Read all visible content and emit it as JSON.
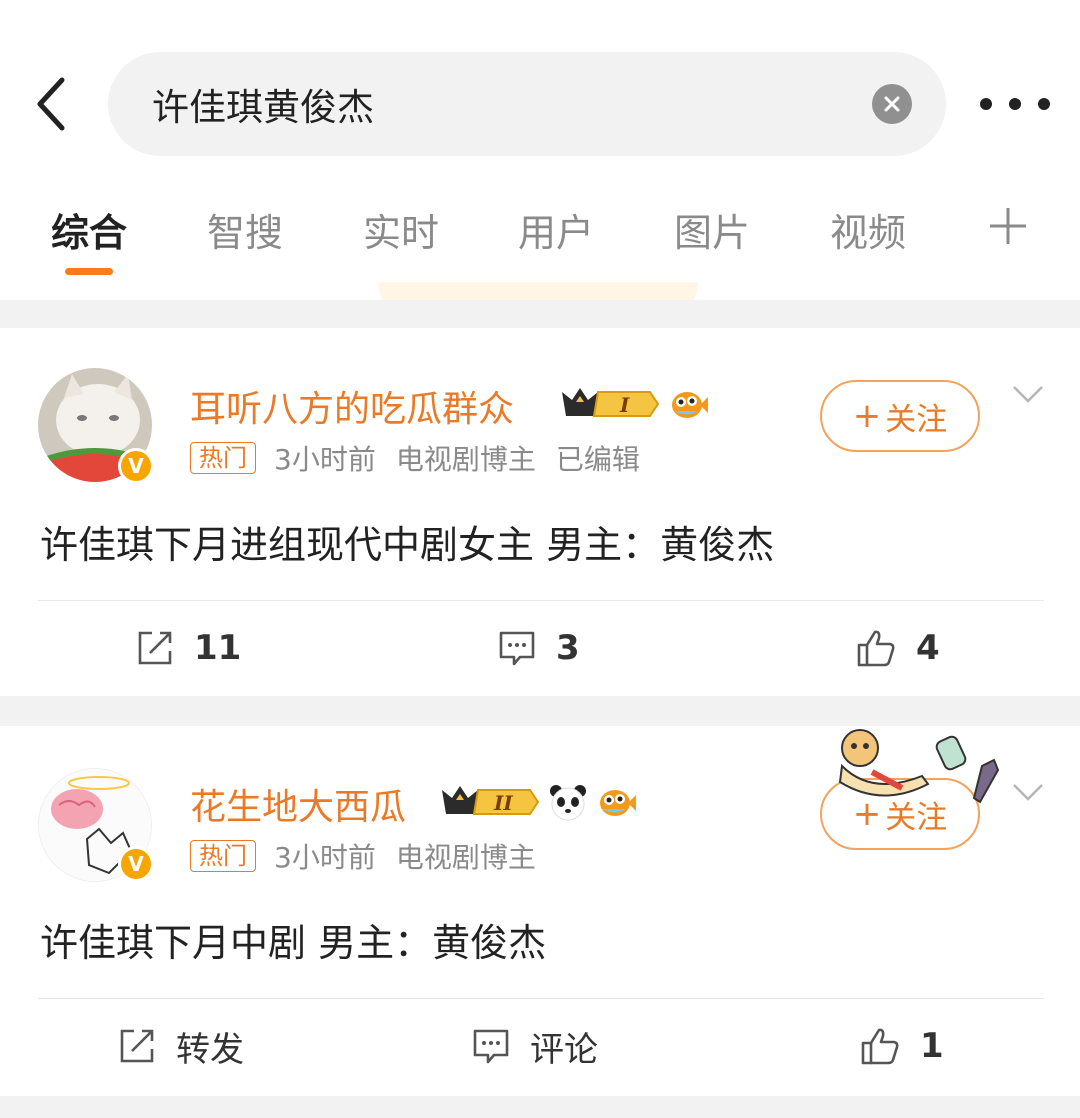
{
  "search": {
    "query": "许佳琪黄俊杰"
  },
  "tabs": [
    {
      "label": "综合",
      "active": true
    },
    {
      "label": "智搜"
    },
    {
      "label": "实时"
    },
    {
      "label": "用户"
    },
    {
      "label": "图片"
    },
    {
      "label": "视频"
    }
  ],
  "posts": [
    {
      "author": "耳听八方的吃瓜群众",
      "level_badge": "I",
      "hot_tag": "热门",
      "time": "3小时前",
      "category": "电视剧博主",
      "edited": "已编辑",
      "follow_label": "关注",
      "text": "许佳琪下月进组现代中剧女主  男主：黄俊杰",
      "reposts": "11",
      "comments": "3",
      "likes": "4"
    },
    {
      "author": "花生地大西瓜",
      "level_badge": "II",
      "hot_tag": "热门",
      "time": "3小时前",
      "category": "电视剧博主",
      "follow_label": "关注",
      "text": "许佳琪下月中剧 男主：黄俊杰",
      "repost_label": "转发",
      "comment_label": "评论",
      "likes": "1"
    }
  ],
  "colors": {
    "accent": "#eb7a27",
    "tab_indicator": "#ff7a18",
    "verified": "#f7a600"
  }
}
